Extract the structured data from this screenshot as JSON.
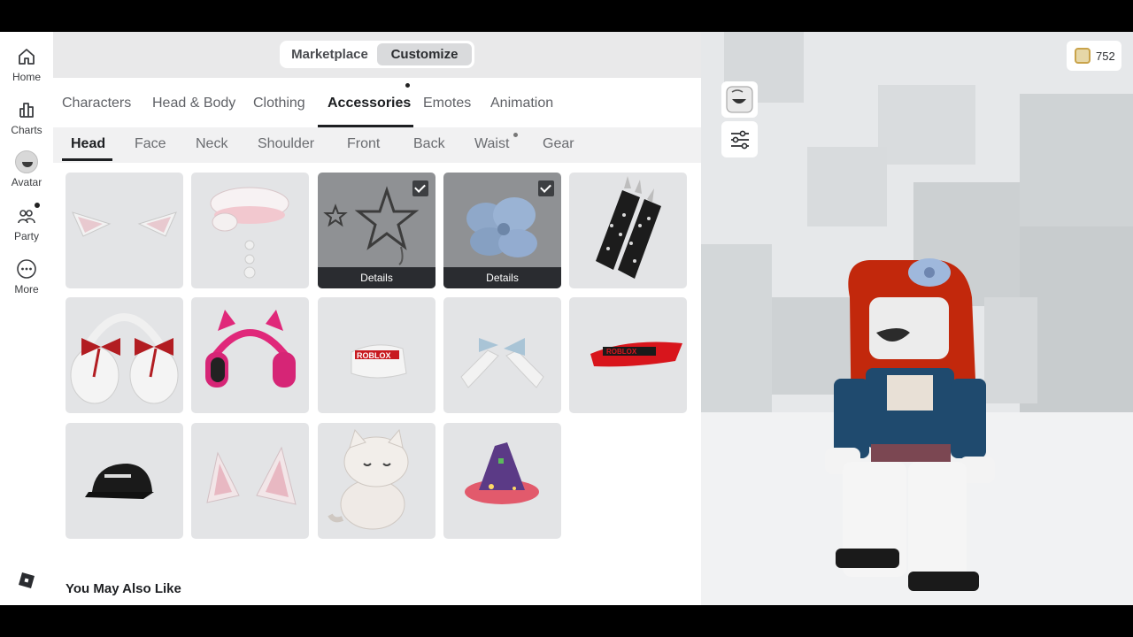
{
  "nav": {
    "items": [
      {
        "label": "Home",
        "icon": "home-icon"
      },
      {
        "label": "Charts",
        "icon": "charts-icon"
      },
      {
        "label": "Avatar",
        "icon": "avatar-icon"
      },
      {
        "label": "Party",
        "icon": "party-icon"
      },
      {
        "label": "More",
        "icon": "more-icon"
      }
    ]
  },
  "segment": {
    "marketplace": "Marketplace",
    "customize": "Customize",
    "active": "Customize"
  },
  "category_tabs": [
    "Characters",
    "Head & Body",
    "Clothing",
    "Accessories",
    "Emotes",
    "Animation"
  ],
  "active_category": "Accessories",
  "sub_tabs": [
    "Head",
    "Face",
    "Neck",
    "Shoulder",
    "Front",
    "Back",
    "Waist",
    "Gear"
  ],
  "active_sub_tab": "Head",
  "items": [
    {
      "name": "white-cat-ears",
      "selected": false
    },
    {
      "name": "pink-pig-beret",
      "selected": false
    },
    {
      "name": "star-hair-clip",
      "selected": true,
      "details_label": "Details"
    },
    {
      "name": "blue-hibiscus-flower",
      "selected": true,
      "details_label": "Details"
    },
    {
      "name": "black-spiked-clip",
      "selected": false
    },
    {
      "name": "white-bow-earmuffs",
      "selected": false
    },
    {
      "name": "pink-cat-headphones",
      "selected": false
    },
    {
      "name": "roblox-white-visor",
      "selected": false
    },
    {
      "name": "blue-gingham-bows",
      "selected": false
    },
    {
      "name": "roblox-red-visor",
      "selected": false
    },
    {
      "name": "roblox-black-cap",
      "selected": false
    },
    {
      "name": "pink-fox-ears",
      "selected": false
    },
    {
      "name": "white-cat-plush",
      "selected": false
    },
    {
      "name": "galaxy-witch-hat",
      "selected": false
    }
  ],
  "section_title": "You May Also Like",
  "robux": {
    "amount": "752"
  },
  "colors": {
    "accent": "#1d1f22",
    "tile_bg": "#e3e4e6",
    "selected_tile": "#8f9194"
  }
}
